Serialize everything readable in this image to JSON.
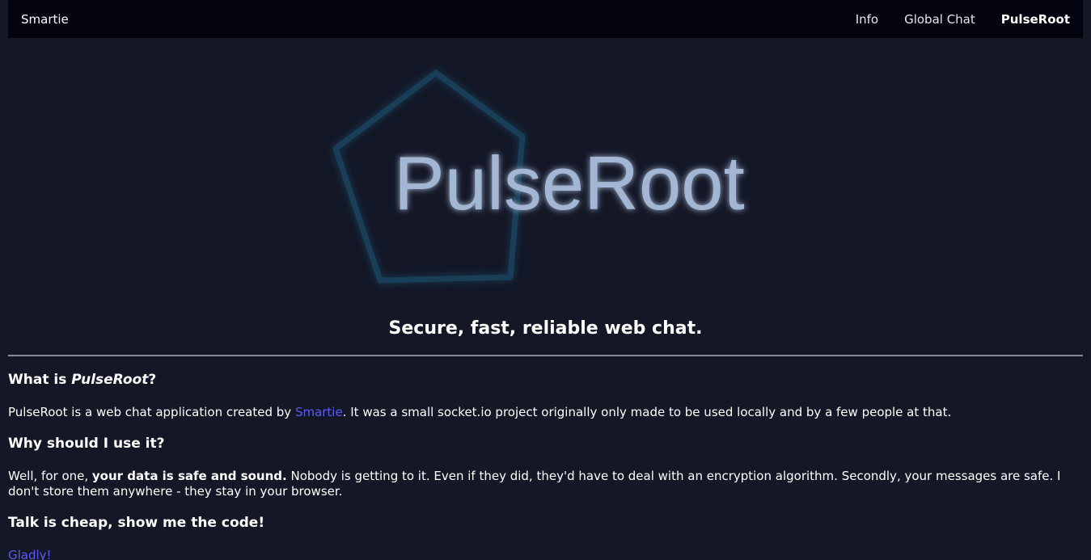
{
  "nav": {
    "brand": "Smartie",
    "links": [
      {
        "label": "Info"
      },
      {
        "label": "Global Chat"
      },
      {
        "label": "PulseRoot"
      }
    ]
  },
  "hero": {
    "logo_text": "PulseRoot",
    "tagline": "Secure, fast, reliable web chat."
  },
  "sections": {
    "what": {
      "heading_prefix": "What is ",
      "heading_em": "PulseRoot",
      "heading_suffix": "?",
      "text_before": "PulseRoot is a web chat application created by ",
      "link": "Smartie",
      "text_after": ". It was a small socket.io project originally only made to be used locally and by a few people at that."
    },
    "why": {
      "heading": "Why should I use it?",
      "text_before": "Well, for one, ",
      "bold": "your data is safe and sound.",
      "text_after": " Nobody is getting to it. Even if they did, they'd have to deal with an encryption algorithm. Secondly, your messages are safe. I don't store them anywhere - they stay in your browser."
    },
    "code": {
      "heading": "Talk is cheap, show me the code!",
      "link": "Gladly!"
    }
  },
  "colors": {
    "background": "#141726",
    "navbar": "#02030f",
    "link": "#5b5bf5",
    "logo_outline": "#1d5f82",
    "logo_text": "#a3b7d4"
  }
}
